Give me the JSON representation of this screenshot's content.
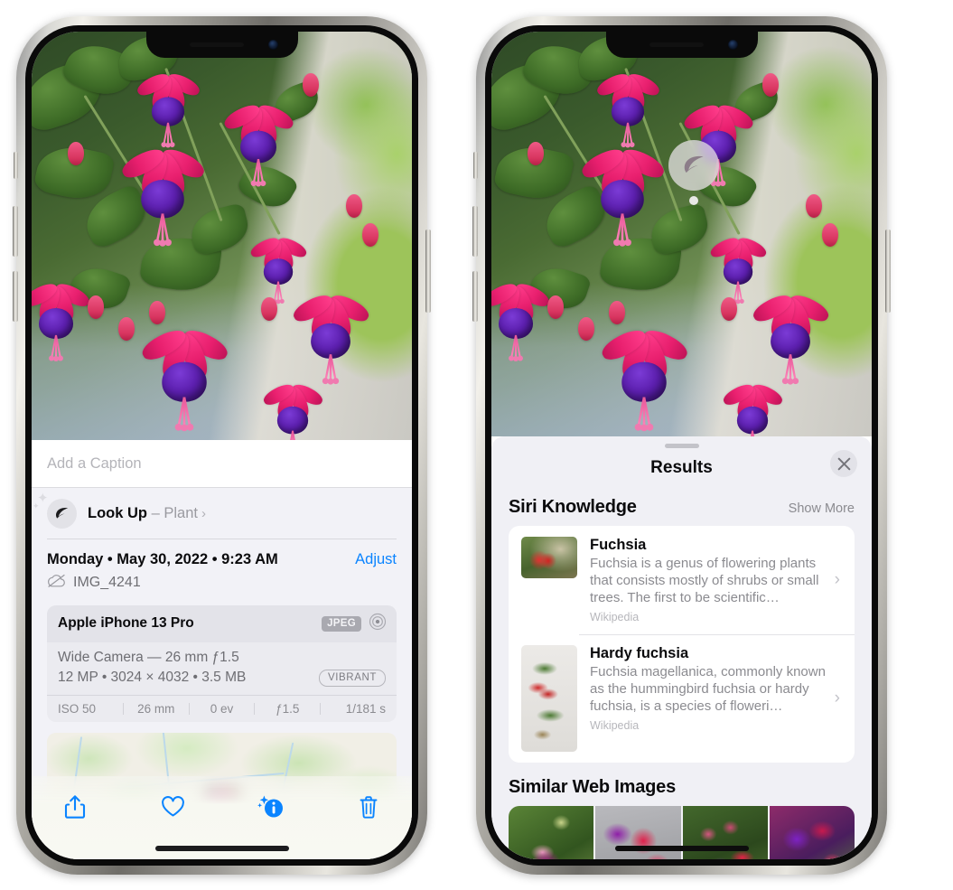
{
  "left_phone": {
    "name": "photos-detail-screen",
    "photo": {
      "alt": "fuchsia-flowers-photo"
    },
    "caption": {
      "placeholder": "Add a Caption",
      "value": ""
    },
    "look_up": {
      "icon": "leaf-icon",
      "sparkle_icon": "sparkles-icon",
      "label": "Look Up",
      "separator": "–",
      "subject": "Plant",
      "chevron": "›"
    },
    "meta": {
      "date": "Monday • May 30, 2022 • 9:23 AM",
      "adjust_label": "Adjust",
      "cloud_icon": "icloud-slash-icon",
      "filename": "IMG_4241"
    },
    "camera_card": {
      "device": "Apple iPhone 13 Pro",
      "format_chip": "JPEG",
      "aperture_icon": "camera-aperture-icon",
      "lens": "Wide Camera — 26 mm ƒ1.5",
      "specs": "12 MP • 3024 × 4032 • 3.5 MB",
      "style_chip": "VIBRANT",
      "exif": [
        "ISO 50",
        "26 mm",
        "0 ev",
        "ƒ1.5",
        "1/181 s"
      ]
    },
    "map": {
      "name": "location-map",
      "pin": "photo-thumbnail-pin"
    },
    "toolbar": [
      {
        "name": "share-button",
        "icon": "share-icon"
      },
      {
        "name": "favorite-button",
        "icon": "heart-icon"
      },
      {
        "name": "info-button",
        "icon": "info-sparkle-icon"
      },
      {
        "name": "delete-button",
        "icon": "trash-icon"
      }
    ]
  },
  "right_phone": {
    "name": "visual-look-up-results-screen",
    "badge": {
      "icon": "leaf-icon",
      "name": "visual-look-up-badge"
    },
    "sheet": {
      "title": "Results",
      "close_icon": "close-icon",
      "sections": [
        {
          "title": "Siri Knowledge",
          "action": "Show More",
          "items": [
            {
              "title": "Fuchsia",
              "description": "Fuchsia is a genus of flowering plants that consists mostly of shrubs or small trees. The first to be scientific…",
              "source": "Wikipedia",
              "chevron": "›",
              "thumb": "fuchsia-red-flowers-thumbnail"
            },
            {
              "title": "Hardy fuchsia",
              "description": "Fuchsia magellanica, commonly known as the hummingbird fuchsia or hardy fuchsia, is a species of floweri…",
              "source": "Wikipedia",
              "chevron": "›",
              "thumb": "hardy-fuchsia-specimen-thumbnail"
            }
          ]
        },
        {
          "title": "Similar Web Images",
          "images": [
            "fuchsia-pink-white-flower",
            "fuchsia-red-magenta-closeup",
            "fuchsia-bush-with-buds",
            "fuchsia-purple-magenta-blooms"
          ]
        }
      ]
    }
  },
  "colors": {
    "accent_blue": "#0a84ff",
    "sheet_bg": "#f0f0f5",
    "panel_bg": "#f2f2f7",
    "card_bg": "#ffffff",
    "secondary_text": "#8b8b90"
  }
}
